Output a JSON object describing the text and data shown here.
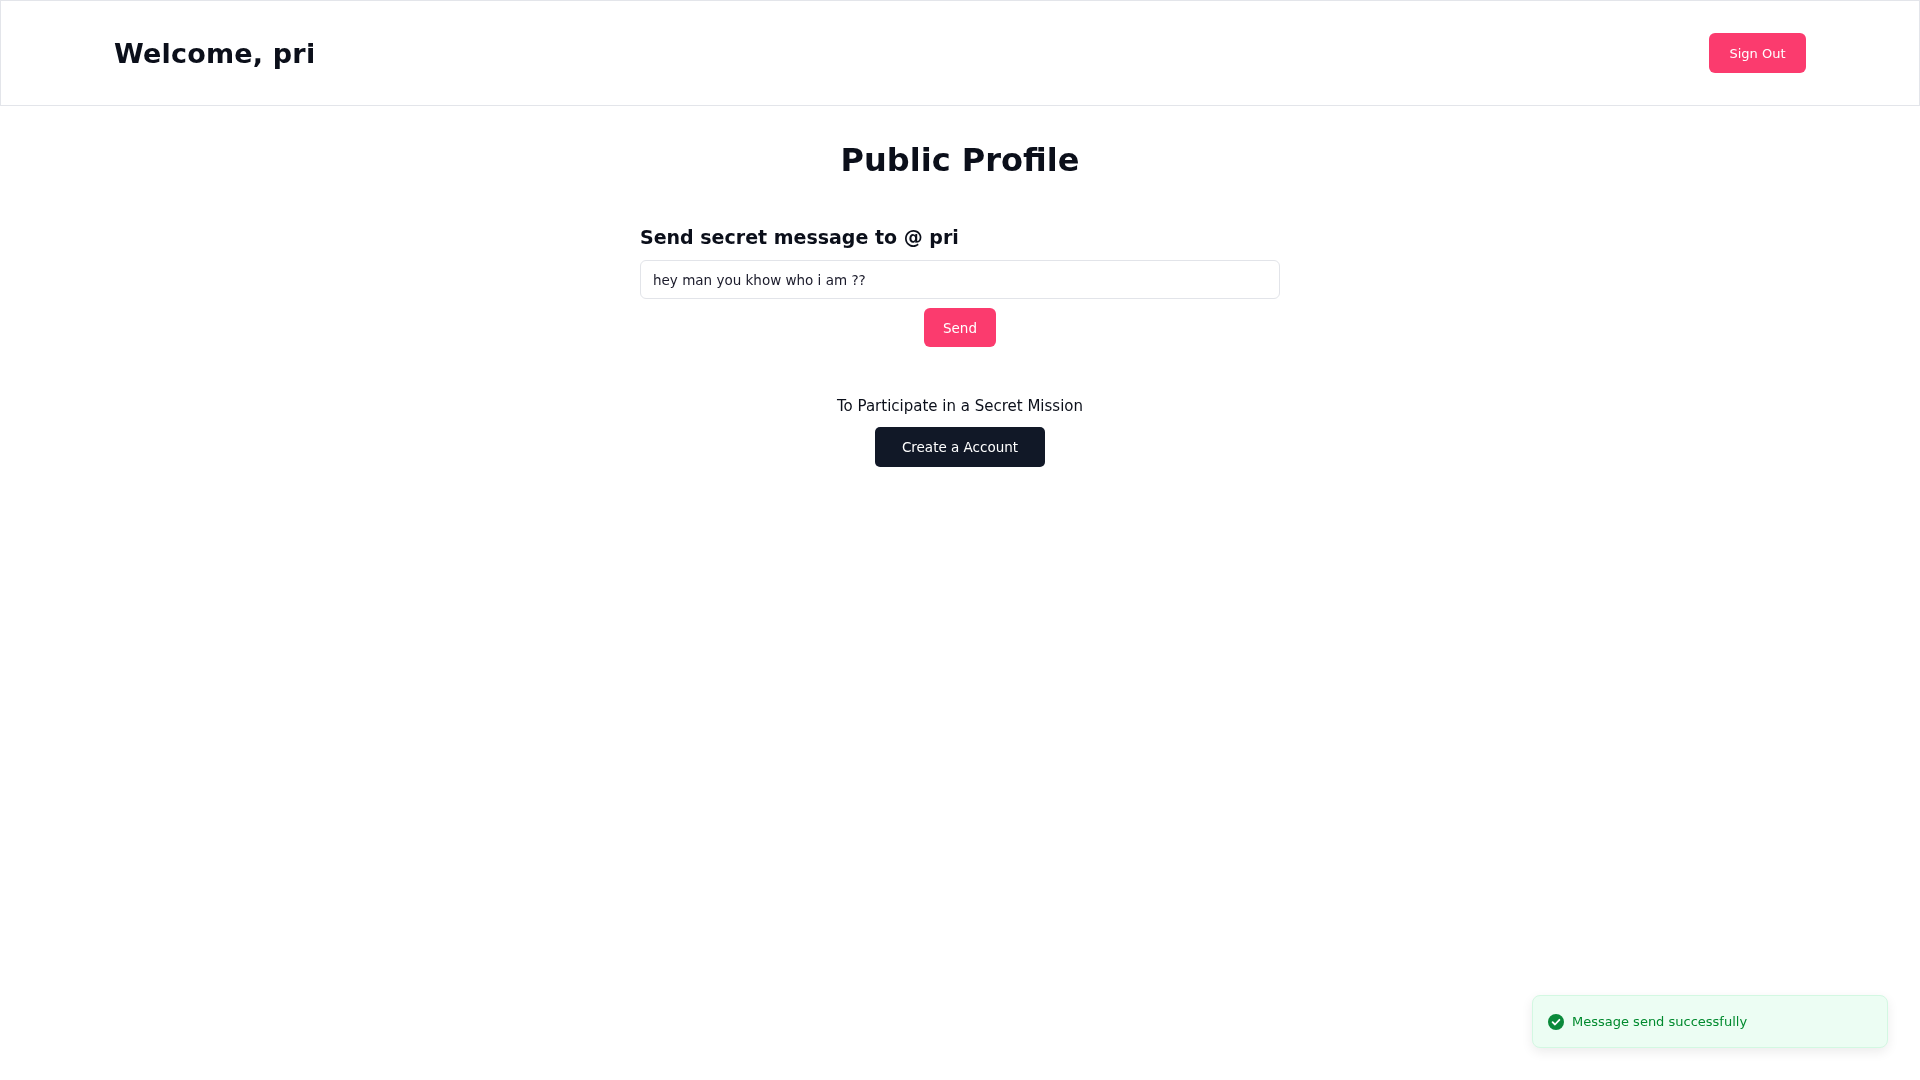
{
  "header": {
    "greeting": "Welcome, pri",
    "sign_out_button": "Sign Out"
  },
  "main": {
    "title": "Public Profile",
    "message_label": "Send secret message to @ pri",
    "message_input": {
      "value": "hey man you khow who i am ??"
    },
    "send_button": "Send",
    "cta_text": "To Participate in a Secret Mission",
    "create_account_button": "Create a Account"
  },
  "toast": {
    "kind": "success",
    "message": "Message send successfully"
  }
}
